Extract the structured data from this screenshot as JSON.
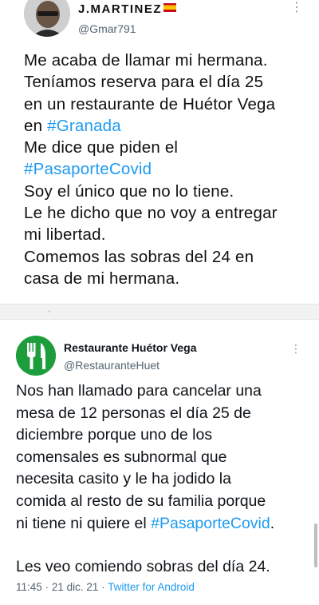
{
  "tweet1": {
    "name": "J.MARTINEZ",
    "flag_icon": "spain-flag-icon",
    "handle": "@Gmar791",
    "more": "⋮",
    "lines": [
      [
        {
          "t": "Me acaba de llamar mi hermana."
        }
      ],
      [
        {
          "t": "Teníamos reserva para el día 25"
        }
      ],
      [
        {
          "t": "en un restaurante de Huétor Vega"
        }
      ],
      [
        {
          "t": "en "
        },
        {
          "t": "#Granada",
          "tag": true
        }
      ],
      [
        {
          "t": "Me dice que piden el"
        }
      ],
      [
        {
          "t": "#PasaporteCovid",
          "tag": true
        }
      ],
      [
        {
          "t": "Soy el único que no lo tiene."
        }
      ],
      [
        {
          "t": "Le he dicho que no voy a entregar"
        }
      ],
      [
        {
          "t": "mi libertad."
        }
      ],
      [
        {
          "t": "Comemos las sobras del 24 en"
        }
      ],
      [
        {
          "t": "casa de mi hermana."
        }
      ]
    ]
  },
  "tweet2": {
    "name": "Restaurante Huétor Vega",
    "handle": "@RestauranteHuet",
    "more": "⋮",
    "avatar_icon": "fork-knife-icon",
    "lines": [
      [
        {
          "t": "Nos han llamado para cancelar una"
        }
      ],
      [
        {
          "t": "mesa de 12 personas el día 25 de"
        }
      ],
      [
        {
          "t": "diciembre porque uno de los"
        }
      ],
      [
        {
          "t": "comensales es subnormal que"
        }
      ],
      [
        {
          "t": "necesita casito y le ha jodido la"
        }
      ],
      [
        {
          "t": "comida al resto de su familia porque"
        }
      ],
      [
        {
          "t": "ni tiene ni quiere el "
        },
        {
          "t": "#PasaporteCovid",
          "tag": true
        },
        {
          "t": "."
        }
      ],
      [],
      [
        {
          "t": "Les veo comiendo sobras del día 24."
        }
      ]
    ],
    "time": "11:45",
    "date": "21 dic. 21",
    "source": "Twitter for Android",
    "separator": "·"
  },
  "colors": {
    "link": "#1d9bf0",
    "avatar_green": "#1d9d3c",
    "secondary_text": "#536471"
  }
}
